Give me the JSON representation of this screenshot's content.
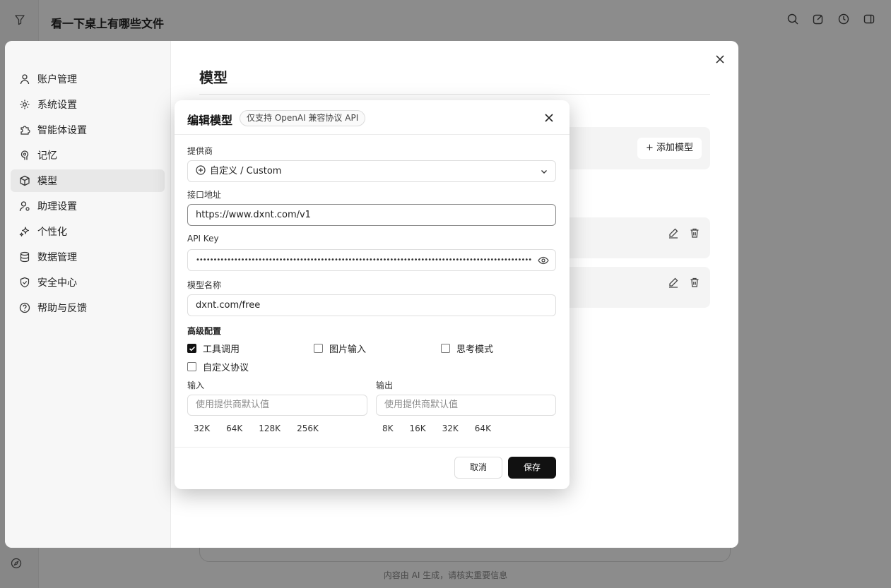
{
  "app": {
    "title": "看一下桌上有哪些文件",
    "footer_note": "内容由 AI 生成，请核实重要信息"
  },
  "settings": {
    "sidebar": [
      {
        "label": "账户管理",
        "icon": "user-icon",
        "active": false
      },
      {
        "label": "系统设置",
        "icon": "gear-icon",
        "active": false
      },
      {
        "label": "智能体设置",
        "icon": "puzzle-icon",
        "active": false
      },
      {
        "label": "记忆",
        "icon": "brain-icon",
        "active": false
      },
      {
        "label": "模型",
        "icon": "cube-icon",
        "active": true
      },
      {
        "label": "助理设置",
        "icon": "user-settings-icon",
        "active": false
      },
      {
        "label": "个性化",
        "icon": "sparkles-icon",
        "active": false
      },
      {
        "label": "数据管理",
        "icon": "database-icon",
        "active": false
      },
      {
        "label": "安全中心",
        "icon": "shield-icon",
        "active": false
      },
      {
        "label": "帮助与反馈",
        "icon": "help-circle-icon",
        "active": false
      }
    ],
    "main_title": "模型",
    "add_model_label": "+ 添加模型"
  },
  "modal": {
    "title": "编辑模型",
    "badge": "仅支持 OpenAI 兼容协议 API",
    "provider_label": "提供商",
    "provider_value": "自定义 / Custom",
    "endpoint_label": "接口地址",
    "endpoint_value": "https://www.dxnt.com/v1",
    "apikey_label": "API Key",
    "apikey_value": "••••••••••••••••••••••••••••••••••••••••••••••••••••••••••••••••••••••••••••••••••••••••••••••••••",
    "model_name_label": "模型名称",
    "model_name_value": "dxnt.com/free",
    "advanced_label": "高级配置",
    "options": {
      "tool_call": {
        "label": "工具调用",
        "checked": true
      },
      "image_input": {
        "label": "图片输入",
        "checked": false
      },
      "thinking_mode": {
        "label": "思考模式",
        "checked": false
      },
      "custom_protocol": {
        "label": "自定义协议",
        "checked": false
      }
    },
    "input_label": "输入",
    "input_placeholder": "使用提供商默认值",
    "input_chips": [
      "32K",
      "64K",
      "128K",
      "256K"
    ],
    "output_label": "输出",
    "output_placeholder": "使用提供商默认值",
    "output_chips": [
      "8K",
      "16K",
      "32K",
      "64K"
    ],
    "cancel_label": "取消",
    "save_label": "保存"
  }
}
